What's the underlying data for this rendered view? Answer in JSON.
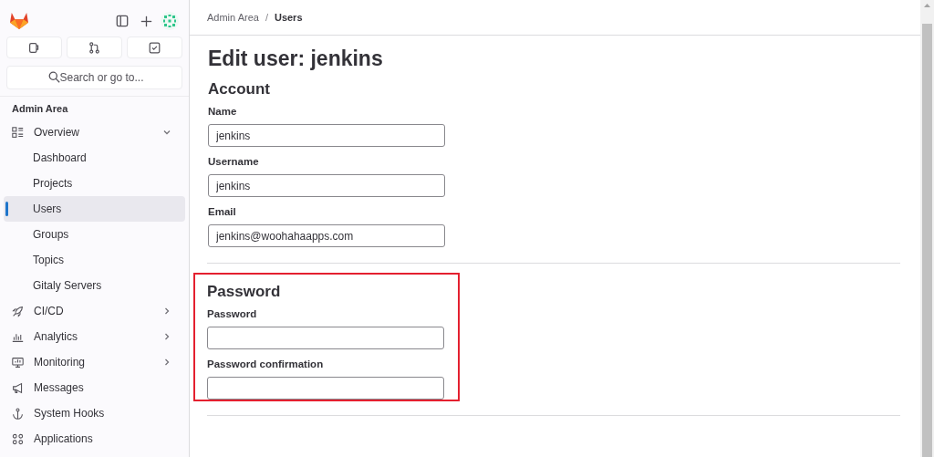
{
  "sidebar": {
    "search": {
      "placeholder": "Search or go to..."
    },
    "section_title": "Admin Area",
    "items": [
      {
        "label": "Overview",
        "kind": "group",
        "expanded": true,
        "children": [
          {
            "label": "Dashboard",
            "selected": false
          },
          {
            "label": "Projects",
            "selected": false
          },
          {
            "label": "Users",
            "selected": true
          },
          {
            "label": "Groups",
            "selected": false
          },
          {
            "label": "Topics",
            "selected": false
          },
          {
            "label": "Gitaly Servers",
            "selected": false
          }
        ]
      },
      {
        "label": "CI/CD",
        "kind": "group",
        "expanded": false
      },
      {
        "label": "Analytics",
        "kind": "group",
        "expanded": false
      },
      {
        "label": "Monitoring",
        "kind": "group",
        "expanded": false
      },
      {
        "label": "Messages",
        "kind": "link"
      },
      {
        "label": "System Hooks",
        "kind": "link"
      },
      {
        "label": "Applications",
        "kind": "link"
      }
    ]
  },
  "breadcrumb_separator": "/",
  "breadcrumb": [
    {
      "label": "Admin Area",
      "selected": false
    },
    {
      "label": "Users",
      "selected": true
    }
  ],
  "title": "Edit user: jenkins",
  "sections": [
    {
      "title": "Account",
      "highlighted": false,
      "fields": [
        {
          "label": "Name",
          "value": "jenkins"
        },
        {
          "label": "Username",
          "value": "jenkins"
        },
        {
          "label": "Email",
          "value": "jenkins@woohahaapps.com"
        }
      ]
    },
    {
      "title": "Password",
      "highlighted": true,
      "fields": [
        {
          "label": "Password"
        },
        {
          "label": "Password confirmation"
        }
      ]
    }
  ]
}
